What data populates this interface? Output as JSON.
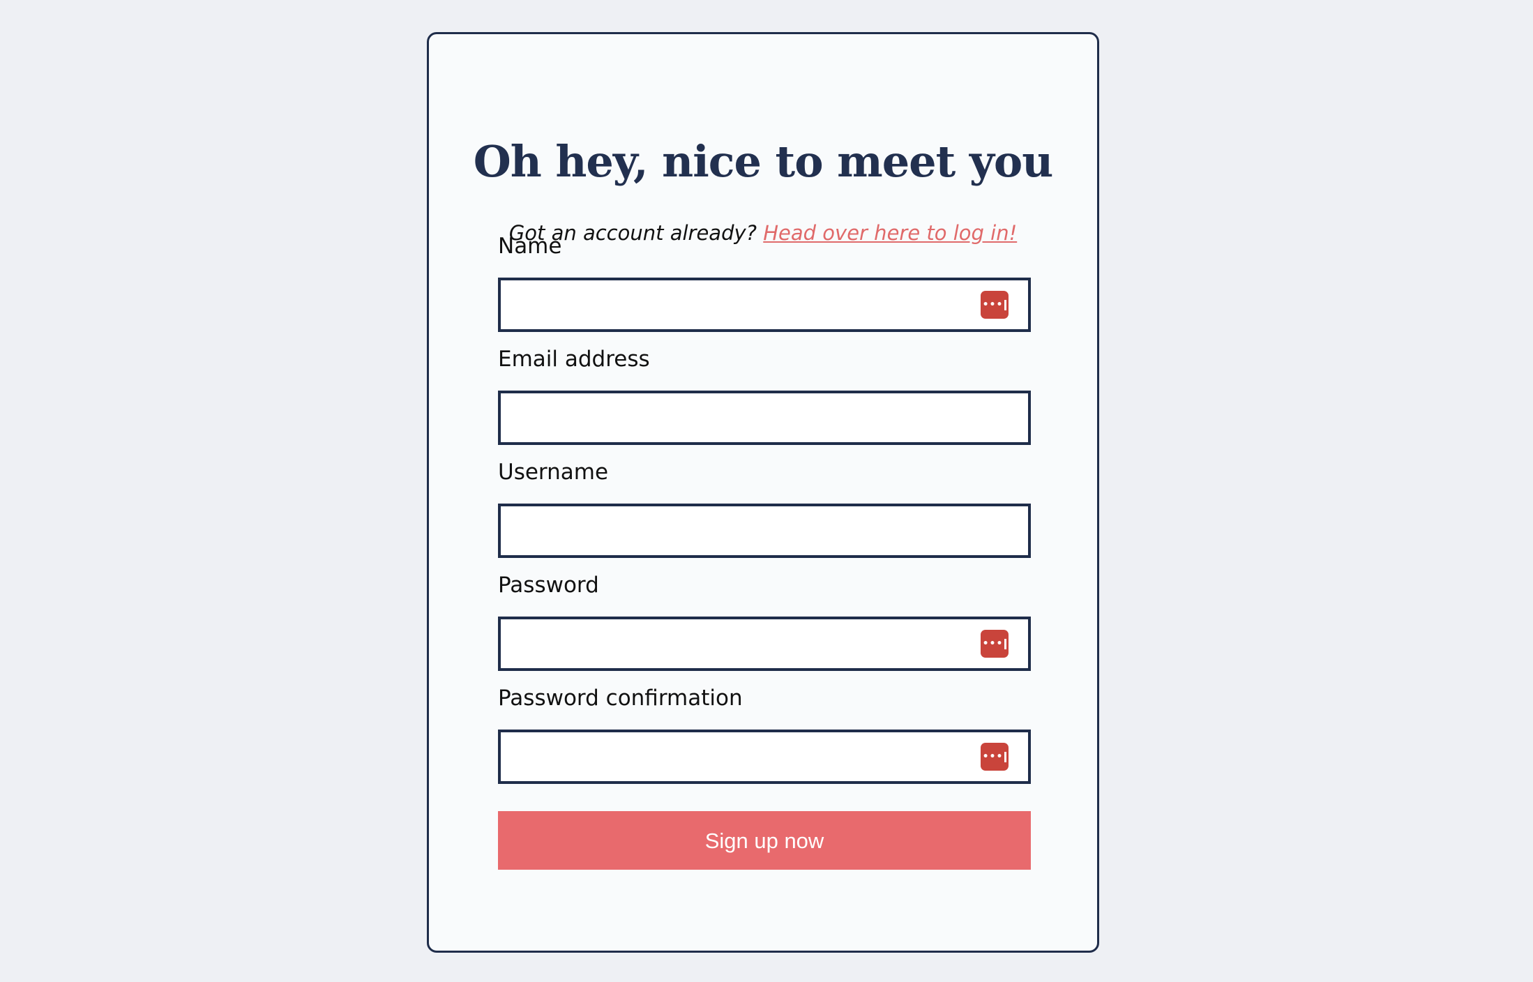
{
  "signup": {
    "title": "Oh hey, nice to meet you",
    "login_prompt": "Got an account already?",
    "login_link": "Head over here to log in!",
    "fields": [
      {
        "label": "Name",
        "value": "",
        "has_autofill_icon": true
      },
      {
        "label": "Email address",
        "value": "",
        "has_autofill_icon": false
      },
      {
        "label": "Username",
        "value": "",
        "has_autofill_icon": false
      },
      {
        "label": "Password",
        "value": "",
        "has_autofill_icon": true
      },
      {
        "label": "Password confirmation",
        "value": "",
        "has_autofill_icon": true
      }
    ],
    "submit_label": "Sign up now",
    "autofill_icon_glyph": "•••"
  },
  "colors": {
    "page_background": "#eef0f4",
    "card_background": "#f9fbfc",
    "border": "#1f2d4a",
    "heading": "#22304f",
    "link": "#e06a6a",
    "button": "#e86a6d",
    "autofill_icon": "#c9443b"
  },
  "icons": {
    "autofill": "password-manager-autofill-icon"
  }
}
